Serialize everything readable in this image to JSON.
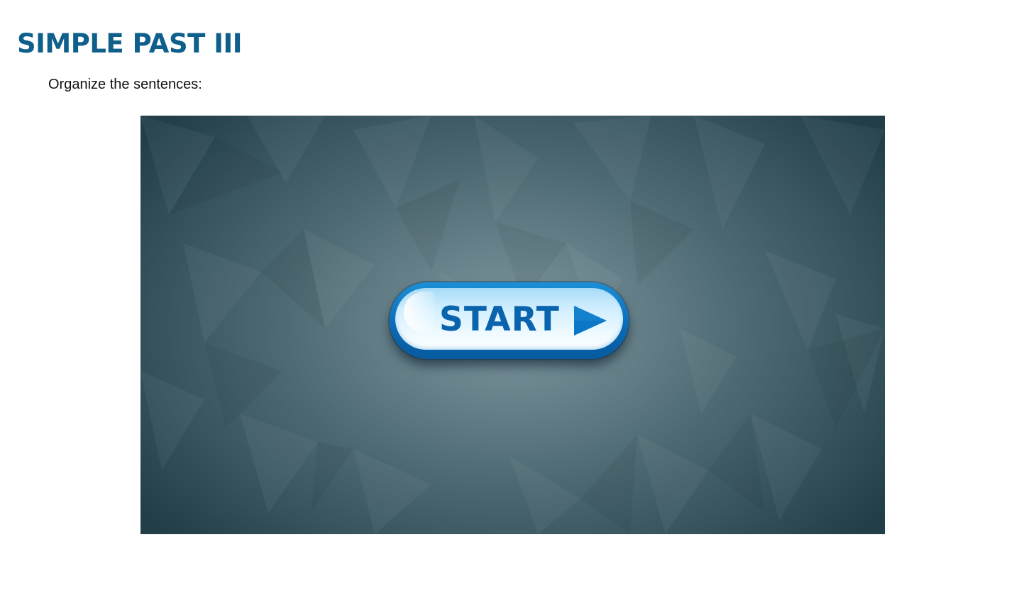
{
  "page": {
    "title": "SIMPLE PAST III",
    "instructions": "Organize the sentences:"
  },
  "game": {
    "start_label": "START",
    "start_icon": "play-triangle-icon"
  },
  "colors": {
    "title": "#0f5f8c",
    "button_blue": "#0b6cb8",
    "button_text": "#0a63ad",
    "stage_center": "#7e979f",
    "stage_edge": "#223f49"
  }
}
